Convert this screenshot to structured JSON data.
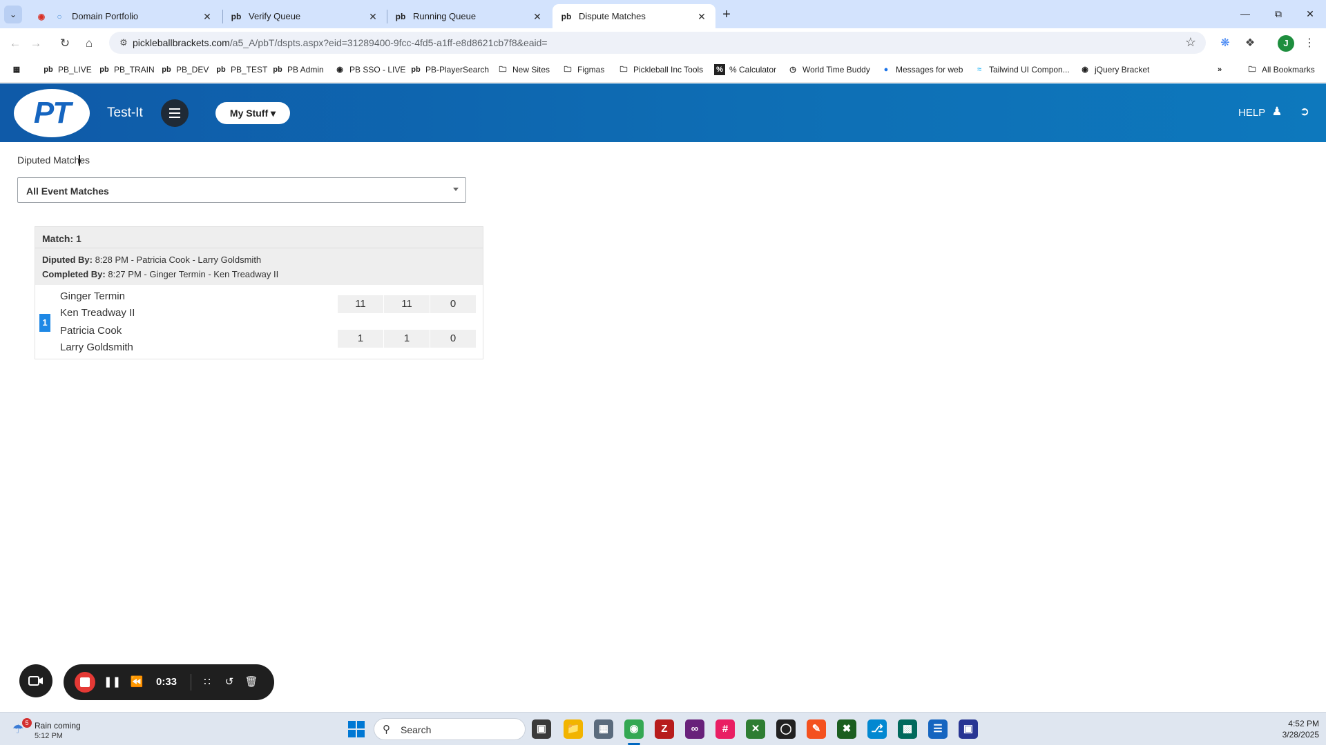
{
  "browser": {
    "tabs": [
      {
        "title": "Domain Portfolio",
        "favicon": "globe-icon",
        "active": false
      },
      {
        "title": "Verify Queue",
        "favicon": "pb-icon",
        "active": false
      },
      {
        "title": "Running Queue",
        "favicon": "pb-icon",
        "active": false
      },
      {
        "title": "Dispute Matches",
        "favicon": "pb-icon",
        "active": true
      }
    ],
    "url_host": "pickleballbrackets.com",
    "url_path": "/a5_A/pbT/dspts.aspx?eid=31289400-9fcc-4fd5-a1ff-e8d8621cb7f8&eaid=",
    "profile_initial": "J",
    "bookmarks": [
      {
        "label": "PB_LIVE",
        "icon": "pb-icon"
      },
      {
        "label": "PB_TRAIN",
        "icon": "pb-icon"
      },
      {
        "label": "PB_DEV",
        "icon": "pb-icon"
      },
      {
        "label": "PB_TEST",
        "icon": "pb-icon"
      },
      {
        "label": "PB Admin",
        "icon": "pb-icon"
      },
      {
        "label": "PB SSO - LIVE",
        "icon": "globe-icon"
      },
      {
        "label": "PB-PlayerSearch",
        "icon": "pb-icon"
      },
      {
        "label": "New Sites",
        "icon": "folder-icon"
      },
      {
        "label": "Figmas",
        "icon": "folder-icon"
      },
      {
        "label": "Pickleball Inc Tools",
        "icon": "folder-icon"
      },
      {
        "label": "% Calculator",
        "icon": "percent-icon"
      },
      {
        "label": "World Time Buddy",
        "icon": "clock-icon"
      },
      {
        "label": "Messages for web",
        "icon": "message-icon"
      },
      {
        "label": "Tailwind UI Compon...",
        "icon": "tailwind-icon"
      },
      {
        "label": "jQuery Bracket",
        "icon": "globe-icon"
      }
    ],
    "all_bookmarks": "All Bookmarks"
  },
  "header": {
    "logo_text": "PT",
    "app_name": "Test-It",
    "my_stuff": "My Stuff",
    "help": "HELP"
  },
  "main": {
    "heading": "Diputed Matches",
    "filter_select": "All Event Matches",
    "match": {
      "label": "Match: 1",
      "disputed_label": "Diputed By:",
      "disputed_value": "8:28 PM - Patricia Cook - Larry Goldsmith",
      "completed_label": "Completed By:",
      "completed_value": "8:27 PM - Ginger Termin - Ken Treadway II",
      "seed": "1",
      "team1": {
        "players": [
          "Ginger Termin",
          "Ken Treadway II"
        ],
        "scores": [
          "11",
          "11",
          "0"
        ]
      },
      "team2": {
        "players": [
          "Patricia Cook",
          "Larry Goldsmith"
        ],
        "scores": [
          "1",
          "1",
          "0"
        ]
      }
    }
  },
  "recorder": {
    "time": "0:33"
  },
  "taskbar": {
    "weather_title": "Rain coming",
    "weather_sub": "5:12 PM",
    "weather_badge": "5",
    "search": "Search",
    "time": "4:52 PM",
    "date": "3/28/2025"
  },
  "colors": {
    "header_blue": "#0f5aa8",
    "seed_blue": "#1e88e5",
    "record_red": "#e53935"
  }
}
